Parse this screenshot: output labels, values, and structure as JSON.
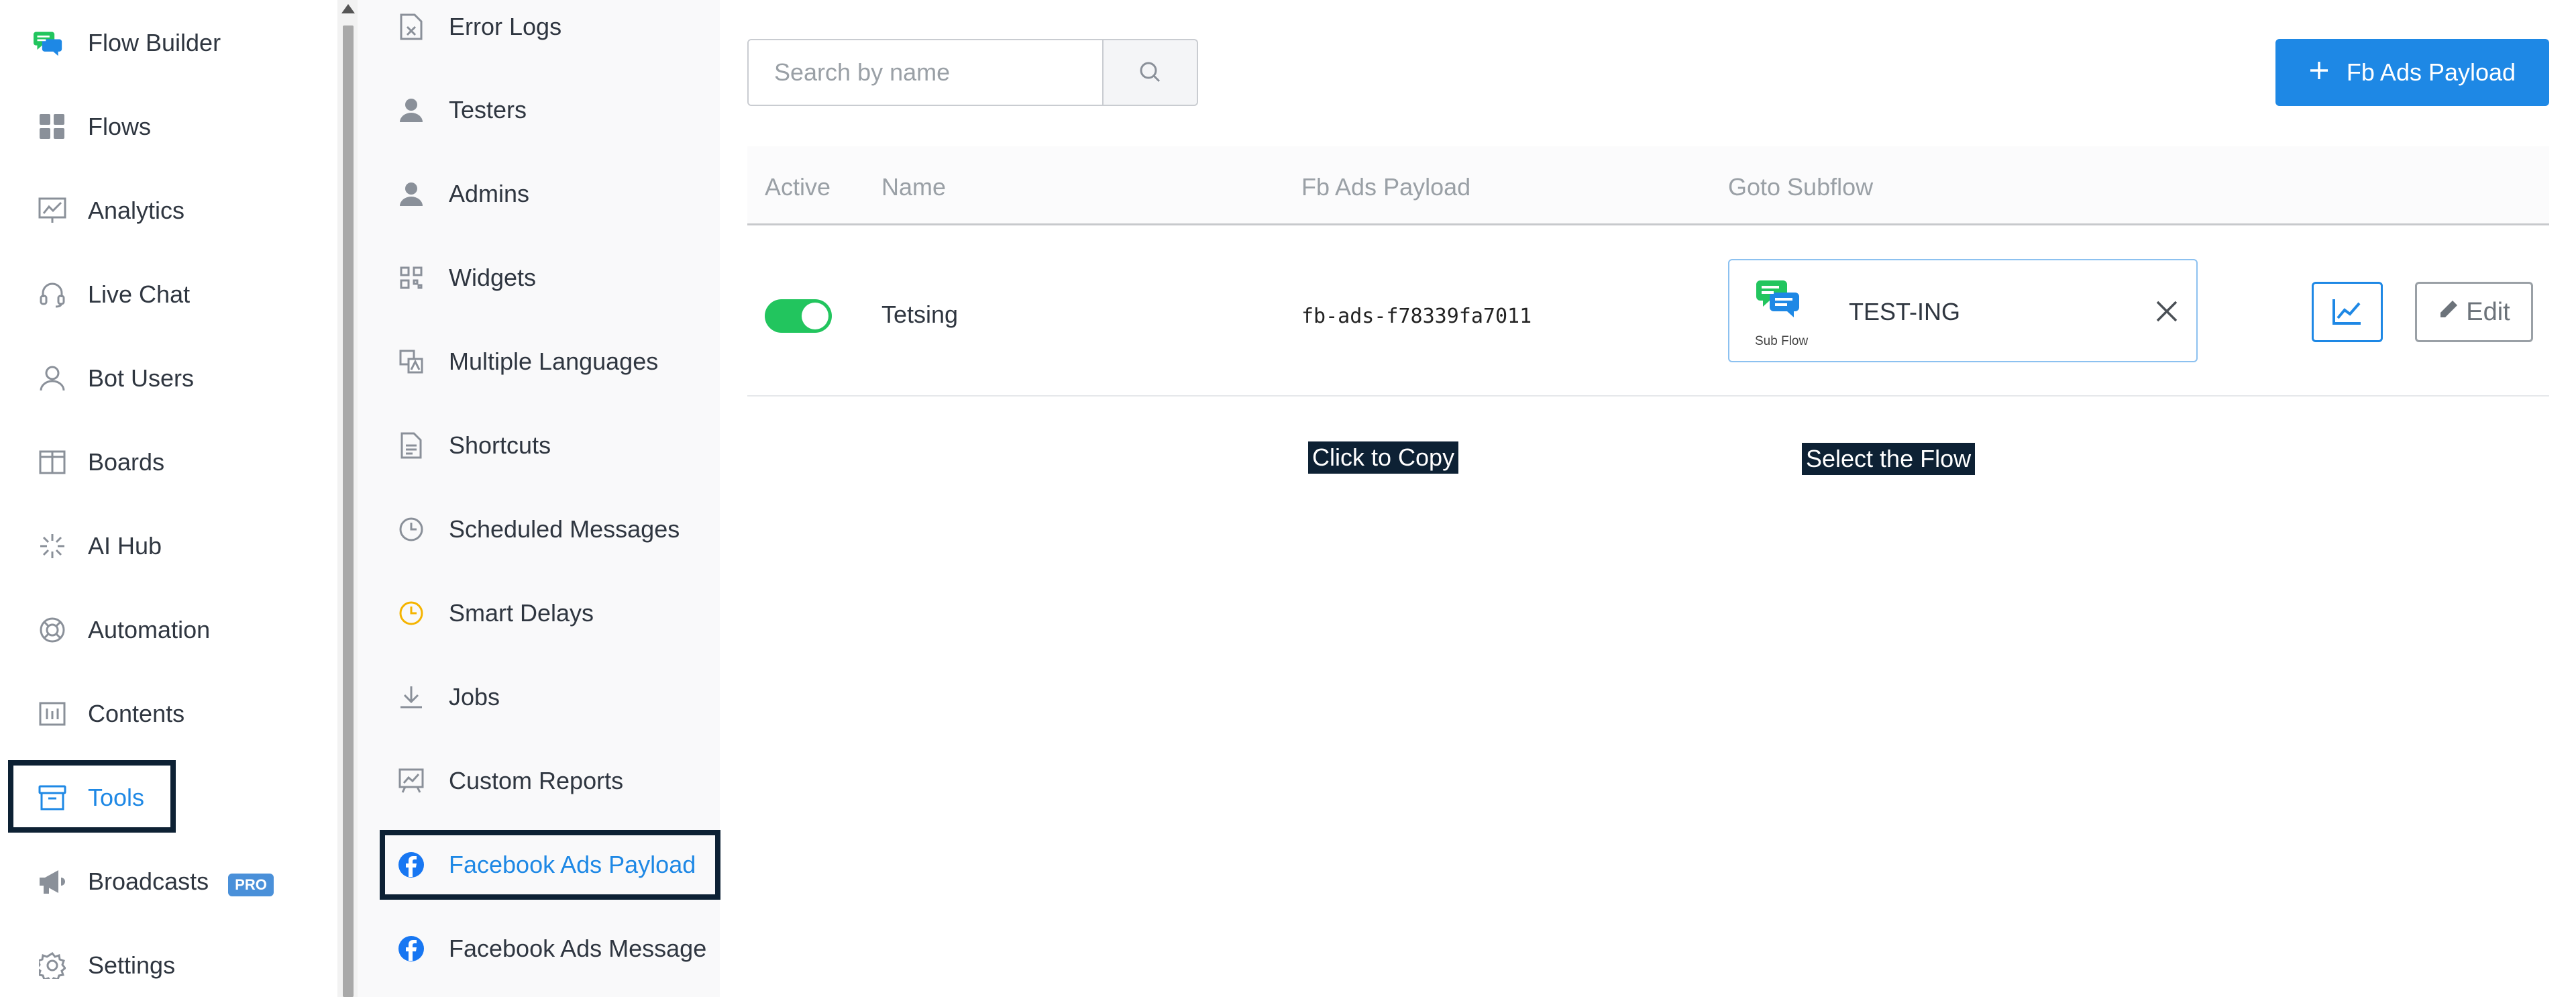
{
  "sidebar": {
    "items": [
      {
        "label": "Flow Builder",
        "icon": "flow-builder-logo-icon"
      },
      {
        "label": "Flows",
        "icon": "grid-icon"
      },
      {
        "label": "Analytics",
        "icon": "analytics-icon"
      },
      {
        "label": "Live Chat",
        "icon": "headset-icon"
      },
      {
        "label": "Bot Users",
        "icon": "user-icon"
      },
      {
        "label": "Boards",
        "icon": "board-icon"
      },
      {
        "label": "AI Hub",
        "icon": "sparkle-icon"
      },
      {
        "label": "Automation",
        "icon": "lifebuoy-icon"
      },
      {
        "label": "Contents",
        "icon": "contents-icon"
      },
      {
        "label": "Tools",
        "icon": "archive-box-icon",
        "active": true
      },
      {
        "label": "Broadcasts",
        "icon": "megaphone-icon",
        "badge": "PRO"
      },
      {
        "label": "Settings",
        "icon": "gear-icon"
      }
    ]
  },
  "submenu": {
    "items": [
      {
        "label": "Error Logs",
        "icon": "error-file-icon"
      },
      {
        "label": "Testers",
        "icon": "user-solid-icon"
      },
      {
        "label": "Admins",
        "icon": "user-solid-icon"
      },
      {
        "label": "Widgets",
        "icon": "qr-icon"
      },
      {
        "label": "Multiple Languages",
        "icon": "translate-icon"
      },
      {
        "label": "Shortcuts",
        "icon": "document-icon"
      },
      {
        "label": "Scheduled Messages",
        "icon": "clock-icon"
      },
      {
        "label": "Smart Delays",
        "icon": "clock-yellow-icon"
      },
      {
        "label": "Jobs",
        "icon": "download-icon"
      },
      {
        "label": "Custom Reports",
        "icon": "report-icon"
      },
      {
        "label": "Facebook Ads Payload",
        "icon": "facebook-icon",
        "active": true
      },
      {
        "label": "Facebook Ads Message",
        "icon": "facebook-icon"
      }
    ]
  },
  "search": {
    "placeholder": "Search by name",
    "value": ""
  },
  "add_button": {
    "label": "Fb Ads Payload"
  },
  "table": {
    "headers": {
      "active": "Active",
      "name": "Name",
      "payload": "Fb Ads Payload",
      "subflow": "Goto Subflow"
    },
    "rows": [
      {
        "active": true,
        "name": "Tetsing",
        "payload": "fb-ads-f78339fa7011",
        "payload_tooltip": "Click to Copy",
        "subflow_caption": "Sub Flow",
        "subflow_name": "TEST-ING",
        "subflow_tooltip": "Select the Flow",
        "edit_label": "Edit"
      }
    ]
  },
  "colors": {
    "accent": "#1e88e5",
    "toggle_on": "#22c55e",
    "highlight": "#0d2134",
    "tooltip_bg": "#0d2134"
  }
}
